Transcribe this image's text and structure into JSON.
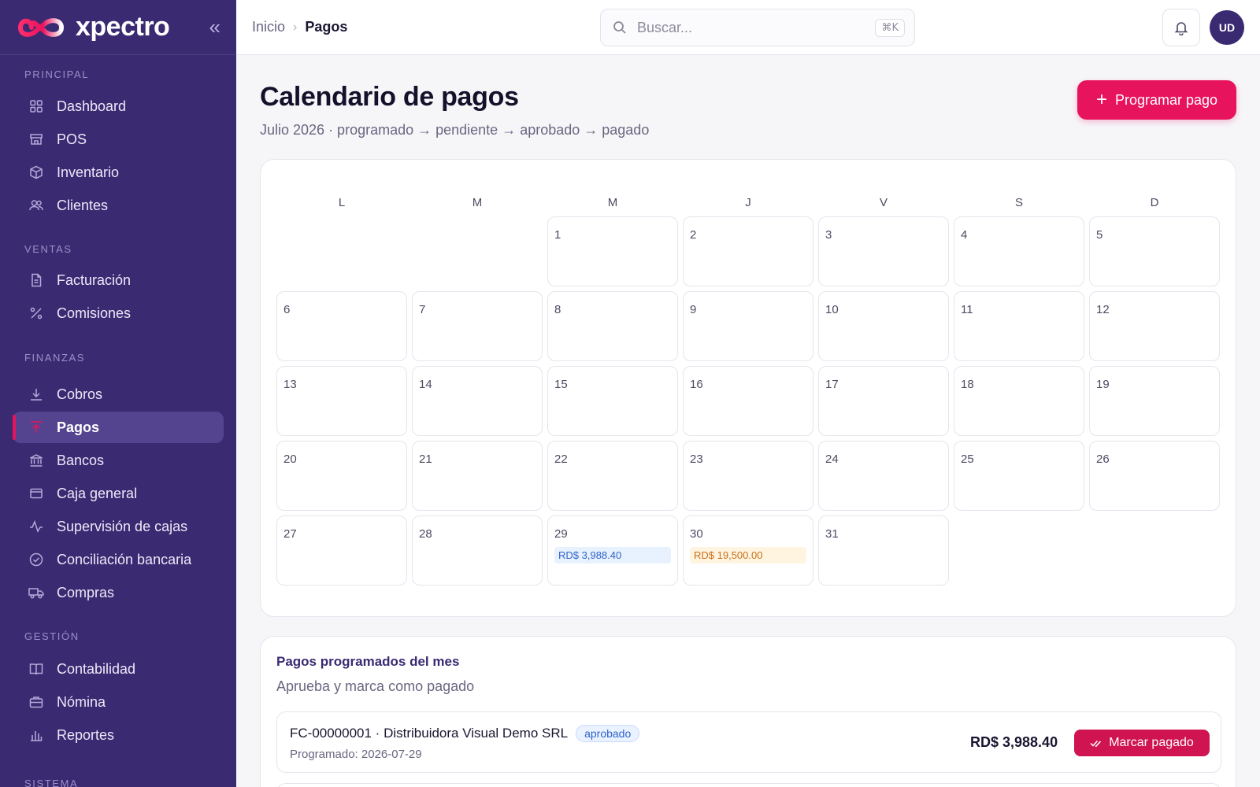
{
  "brand": {
    "name": "xpectro"
  },
  "sidebar": {
    "sections": [
      {
        "label": "PRINCIPAL",
        "items": [
          {
            "label": "Dashboard",
            "icon": "grid-icon"
          },
          {
            "label": "POS",
            "icon": "store-icon"
          },
          {
            "label": "Inventario",
            "icon": "box-icon"
          },
          {
            "label": "Clientes",
            "icon": "users-icon"
          }
        ]
      },
      {
        "label": "VENTAS",
        "items": [
          {
            "label": "Facturación",
            "icon": "file-icon"
          },
          {
            "label": "Comisiones",
            "icon": "percent-icon"
          }
        ]
      },
      {
        "label": "FINANZAS",
        "items": [
          {
            "label": "Cobros",
            "icon": "download-icon"
          },
          {
            "label": "Pagos",
            "icon": "upload-icon",
            "active": true
          },
          {
            "label": "Bancos",
            "icon": "bank-icon"
          },
          {
            "label": "Caja general",
            "icon": "wallet-icon"
          },
          {
            "label": "Supervisión de cajas",
            "icon": "activity-icon"
          },
          {
            "label": "Conciliación bancaria",
            "icon": "check-circle-icon"
          },
          {
            "label": "Compras",
            "icon": "truck-icon"
          }
        ]
      },
      {
        "label": "GESTIÓN",
        "items": [
          {
            "label": "Contabilidad",
            "icon": "book-icon"
          },
          {
            "label": "Nómina",
            "icon": "briefcase-icon"
          },
          {
            "label": "Reportes",
            "icon": "bar-chart-icon"
          }
        ]
      },
      {
        "label": "SISTEMA",
        "items": []
      }
    ]
  },
  "topbar": {
    "breadcrumb": [
      "Inicio",
      "Pagos"
    ],
    "search": {
      "placeholder": "Buscar...",
      "shortcut": "⌘K"
    },
    "avatar": "UD"
  },
  "main": {
    "title": "Calendario de pagos",
    "subtitle": "Julio 2026 · programado → pendiente → aprobado → pagado",
    "primary_button": "Programar pago"
  },
  "calendar": {
    "weekdays": [
      "L",
      "M",
      "M",
      "J",
      "V",
      "S",
      "D"
    ],
    "leading_blanks": 2,
    "days": 31,
    "events": [
      {
        "day": 29,
        "label": "RD$ 3,988.40",
        "tone": "blue"
      },
      {
        "day": 30,
        "label": "RD$ 19,500.00",
        "tone": "orange"
      }
    ]
  },
  "payments": {
    "title": "Pagos programados del mes",
    "subtitle": "Aprueba y marca como pagado",
    "rows": [
      {
        "title": "FC-00000001 · Distribuidora Visual Demo SRL",
        "status": "aprobado",
        "scheduled": "Programado: 2026-07-29",
        "amount": "RD$ 3,988.40",
        "action": "Marcar pagado"
      }
    ]
  },
  "colors": {
    "sidebar": "#3a2a72",
    "accent": "#e8135d",
    "active_item": "#54448f",
    "status_blue": "#2f64c8",
    "status_orange": "#c9701a"
  }
}
